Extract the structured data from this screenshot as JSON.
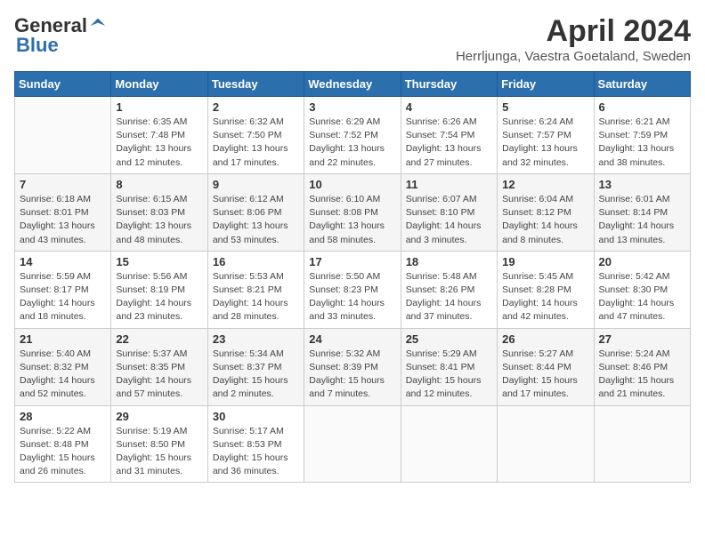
{
  "header": {
    "logo_general": "General",
    "logo_blue": "Blue",
    "month_title": "April 2024",
    "location": "Herrljunga, Vaestra Goetaland, Sweden"
  },
  "days_of_week": [
    "Sunday",
    "Monday",
    "Tuesday",
    "Wednesday",
    "Thursday",
    "Friday",
    "Saturday"
  ],
  "weeks": [
    [
      {
        "day": "",
        "info": ""
      },
      {
        "day": "1",
        "info": "Sunrise: 6:35 AM\nSunset: 7:48 PM\nDaylight: 13 hours\nand 12 minutes."
      },
      {
        "day": "2",
        "info": "Sunrise: 6:32 AM\nSunset: 7:50 PM\nDaylight: 13 hours\nand 17 minutes."
      },
      {
        "day": "3",
        "info": "Sunrise: 6:29 AM\nSunset: 7:52 PM\nDaylight: 13 hours\nand 22 minutes."
      },
      {
        "day": "4",
        "info": "Sunrise: 6:26 AM\nSunset: 7:54 PM\nDaylight: 13 hours\nand 27 minutes."
      },
      {
        "day": "5",
        "info": "Sunrise: 6:24 AM\nSunset: 7:57 PM\nDaylight: 13 hours\nand 32 minutes."
      },
      {
        "day": "6",
        "info": "Sunrise: 6:21 AM\nSunset: 7:59 PM\nDaylight: 13 hours\nand 38 minutes."
      }
    ],
    [
      {
        "day": "7",
        "info": "Sunrise: 6:18 AM\nSunset: 8:01 PM\nDaylight: 13 hours\nand 43 minutes."
      },
      {
        "day": "8",
        "info": "Sunrise: 6:15 AM\nSunset: 8:03 PM\nDaylight: 13 hours\nand 48 minutes."
      },
      {
        "day": "9",
        "info": "Sunrise: 6:12 AM\nSunset: 8:06 PM\nDaylight: 13 hours\nand 53 minutes."
      },
      {
        "day": "10",
        "info": "Sunrise: 6:10 AM\nSunset: 8:08 PM\nDaylight: 13 hours\nand 58 minutes."
      },
      {
        "day": "11",
        "info": "Sunrise: 6:07 AM\nSunset: 8:10 PM\nDaylight: 14 hours\nand 3 minutes."
      },
      {
        "day": "12",
        "info": "Sunrise: 6:04 AM\nSunset: 8:12 PM\nDaylight: 14 hours\nand 8 minutes."
      },
      {
        "day": "13",
        "info": "Sunrise: 6:01 AM\nSunset: 8:14 PM\nDaylight: 14 hours\nand 13 minutes."
      }
    ],
    [
      {
        "day": "14",
        "info": "Sunrise: 5:59 AM\nSunset: 8:17 PM\nDaylight: 14 hours\nand 18 minutes."
      },
      {
        "day": "15",
        "info": "Sunrise: 5:56 AM\nSunset: 8:19 PM\nDaylight: 14 hours\nand 23 minutes."
      },
      {
        "day": "16",
        "info": "Sunrise: 5:53 AM\nSunset: 8:21 PM\nDaylight: 14 hours\nand 28 minutes."
      },
      {
        "day": "17",
        "info": "Sunrise: 5:50 AM\nSunset: 8:23 PM\nDaylight: 14 hours\nand 33 minutes."
      },
      {
        "day": "18",
        "info": "Sunrise: 5:48 AM\nSunset: 8:26 PM\nDaylight: 14 hours\nand 37 minutes."
      },
      {
        "day": "19",
        "info": "Sunrise: 5:45 AM\nSunset: 8:28 PM\nDaylight: 14 hours\nand 42 minutes."
      },
      {
        "day": "20",
        "info": "Sunrise: 5:42 AM\nSunset: 8:30 PM\nDaylight: 14 hours\nand 47 minutes."
      }
    ],
    [
      {
        "day": "21",
        "info": "Sunrise: 5:40 AM\nSunset: 8:32 PM\nDaylight: 14 hours\nand 52 minutes."
      },
      {
        "day": "22",
        "info": "Sunrise: 5:37 AM\nSunset: 8:35 PM\nDaylight: 14 hours\nand 57 minutes."
      },
      {
        "day": "23",
        "info": "Sunrise: 5:34 AM\nSunset: 8:37 PM\nDaylight: 15 hours\nand 2 minutes."
      },
      {
        "day": "24",
        "info": "Sunrise: 5:32 AM\nSunset: 8:39 PM\nDaylight: 15 hours\nand 7 minutes."
      },
      {
        "day": "25",
        "info": "Sunrise: 5:29 AM\nSunset: 8:41 PM\nDaylight: 15 hours\nand 12 minutes."
      },
      {
        "day": "26",
        "info": "Sunrise: 5:27 AM\nSunset: 8:44 PM\nDaylight: 15 hours\nand 17 minutes."
      },
      {
        "day": "27",
        "info": "Sunrise: 5:24 AM\nSunset: 8:46 PM\nDaylight: 15 hours\nand 21 minutes."
      }
    ],
    [
      {
        "day": "28",
        "info": "Sunrise: 5:22 AM\nSunset: 8:48 PM\nDaylight: 15 hours\nand 26 minutes."
      },
      {
        "day": "29",
        "info": "Sunrise: 5:19 AM\nSunset: 8:50 PM\nDaylight: 15 hours\nand 31 minutes."
      },
      {
        "day": "30",
        "info": "Sunrise: 5:17 AM\nSunset: 8:53 PM\nDaylight: 15 hours\nand 36 minutes."
      },
      {
        "day": "",
        "info": ""
      },
      {
        "day": "",
        "info": ""
      },
      {
        "day": "",
        "info": ""
      },
      {
        "day": "",
        "info": ""
      }
    ]
  ]
}
